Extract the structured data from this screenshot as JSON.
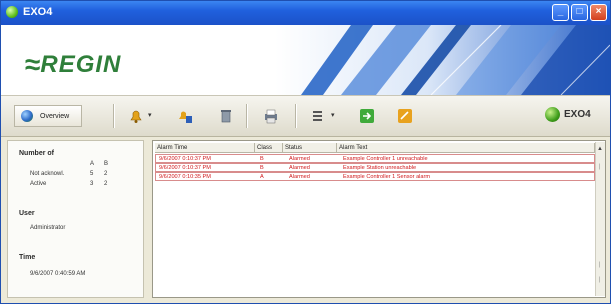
{
  "window": {
    "title": "EXO4",
    "title_bar_color": "#2060dd",
    "app_icon": "green-ball-icon",
    "controls": {
      "minimize": "_",
      "maximize": "□",
      "close": "×"
    }
  },
  "banner": {
    "logo_text": "REGIN",
    "logo_mark": "≈",
    "brand_color": "#2f7f3a",
    "accent_color": "#1f5fc4"
  },
  "toolbar": {
    "overview_label": "Overview",
    "exo_badge_label": "EXO4",
    "icons": [
      "bell-icon",
      "acknowledge-icon",
      "delete-icon",
      "print-icon",
      "filter-icon",
      "export-icon",
      "notes-icon"
    ]
  },
  "left_panel": {
    "number_heading": "Number of",
    "col_a": "A",
    "col_b": "B",
    "not_ack_label": "Not acknowl.",
    "not_ack_a": "5",
    "not_ack_b": "2",
    "active_label": "Active",
    "active_a": "3",
    "active_b": "2",
    "user_heading": "User",
    "user_value": "Administrator",
    "time_heading": "Time",
    "time_value": "9/6/2007 0:40:59 AM"
  },
  "alarm_list": {
    "columns": [
      "Alarm Time",
      "Class",
      "Status",
      "Alarm Text"
    ],
    "alarm_color": "#d0191c",
    "rows": [
      {
        "time": "9/6/2007 0:10:37 PM",
        "class": "B",
        "status": "Alarmed",
        "text": "Example Controller 1 unreachable"
      },
      {
        "time": "9/6/2007 0:10:37 PM",
        "class": "B",
        "status": "Alarmed",
        "text": "Example Station unreachable"
      },
      {
        "time": "9/6/2007 0:10:35 PM",
        "class": "A",
        "status": "Alarmed",
        "text": "Example Controller 1 Sensor alarm"
      }
    ]
  }
}
